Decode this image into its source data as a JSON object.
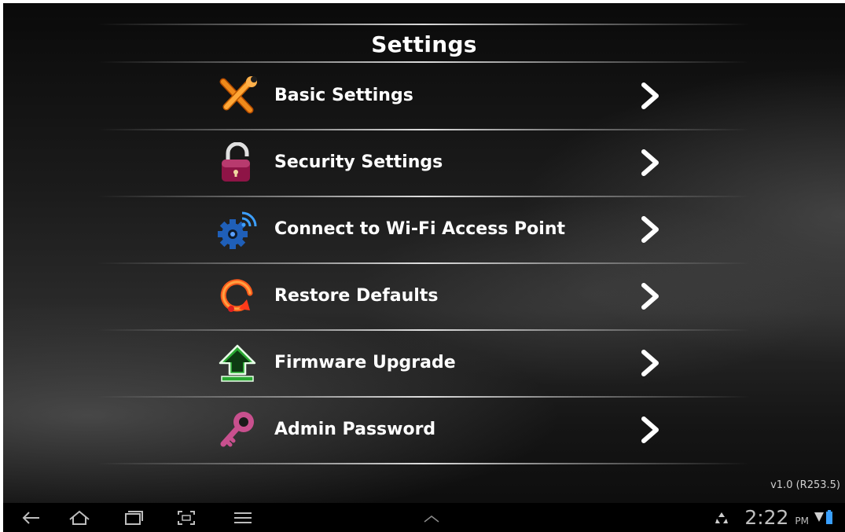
{
  "header": {
    "title": "Settings"
  },
  "menu": {
    "items": [
      {
        "label": "Basic Settings",
        "icon": "tools-icon"
      },
      {
        "label": "Security Settings",
        "icon": "padlock-icon"
      },
      {
        "label": "Connect to Wi-Fi Access Point",
        "icon": "wifi-gear-icon"
      },
      {
        "label": "Restore Defaults",
        "icon": "restore-icon"
      },
      {
        "label": "Firmware Upgrade",
        "icon": "upload-arrow-icon"
      },
      {
        "label": "Admin Password",
        "icon": "key-icon"
      }
    ]
  },
  "footer": {
    "version": "v1.0 (R253.5)"
  },
  "statusbar": {
    "time": "2:22",
    "ampm": "PM"
  },
  "colors": {
    "background": "#1a1a1a",
    "text": "#ffffff",
    "navbar": "#000000"
  }
}
